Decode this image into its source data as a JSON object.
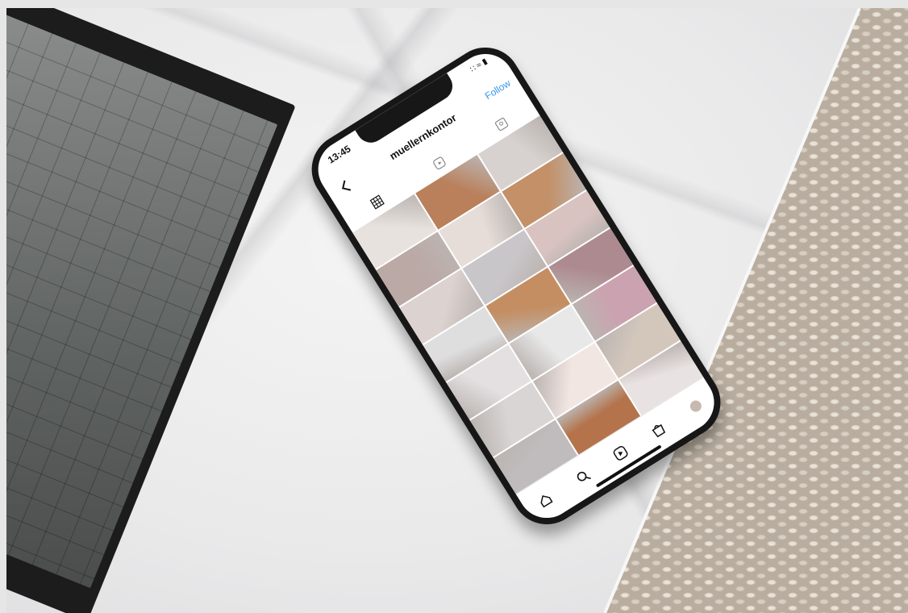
{
  "status_bar": {
    "time": "13:45",
    "signal": "∷ ≈ ▮"
  },
  "profile": {
    "username": "muellernkontor",
    "follow_label": "Follow"
  },
  "tabs": [
    {
      "icon": "grid-icon"
    },
    {
      "icon": "reels-icon"
    },
    {
      "icon": "tagged-icon"
    }
  ],
  "grid_tiles": [
    {
      "color": "#e8e2de"
    },
    {
      "color": "#b9805b"
    },
    {
      "color": "#d7d2cf"
    },
    {
      "color": "#bba9a6"
    },
    {
      "color": "#e6ddd9"
    },
    {
      "color": "#c39067"
    },
    {
      "color": "#dcd2cf"
    },
    {
      "color": "#c9c6c9"
    },
    {
      "color": "#d9c3c1"
    },
    {
      "color": "#dedede"
    },
    {
      "color": "#c48e62"
    },
    {
      "color": "#ad8a90"
    },
    {
      "color": "#e4e0e2"
    },
    {
      "color": "#e8e8e8"
    },
    {
      "color": "#cba2b0"
    },
    {
      "color": "#d8d5d4"
    },
    {
      "color": "#f2e6e3"
    },
    {
      "color": "#d3c7bc"
    },
    {
      "color": "#c0bcbd"
    },
    {
      "color": "#b4734b"
    },
    {
      "color": "#e9e2e2"
    }
  ],
  "bottom_nav": [
    {
      "icon": "home-icon"
    },
    {
      "icon": "search-icon"
    },
    {
      "icon": "reels-nav-icon"
    },
    {
      "icon": "shop-icon"
    },
    {
      "icon": "profile-icon"
    }
  ]
}
